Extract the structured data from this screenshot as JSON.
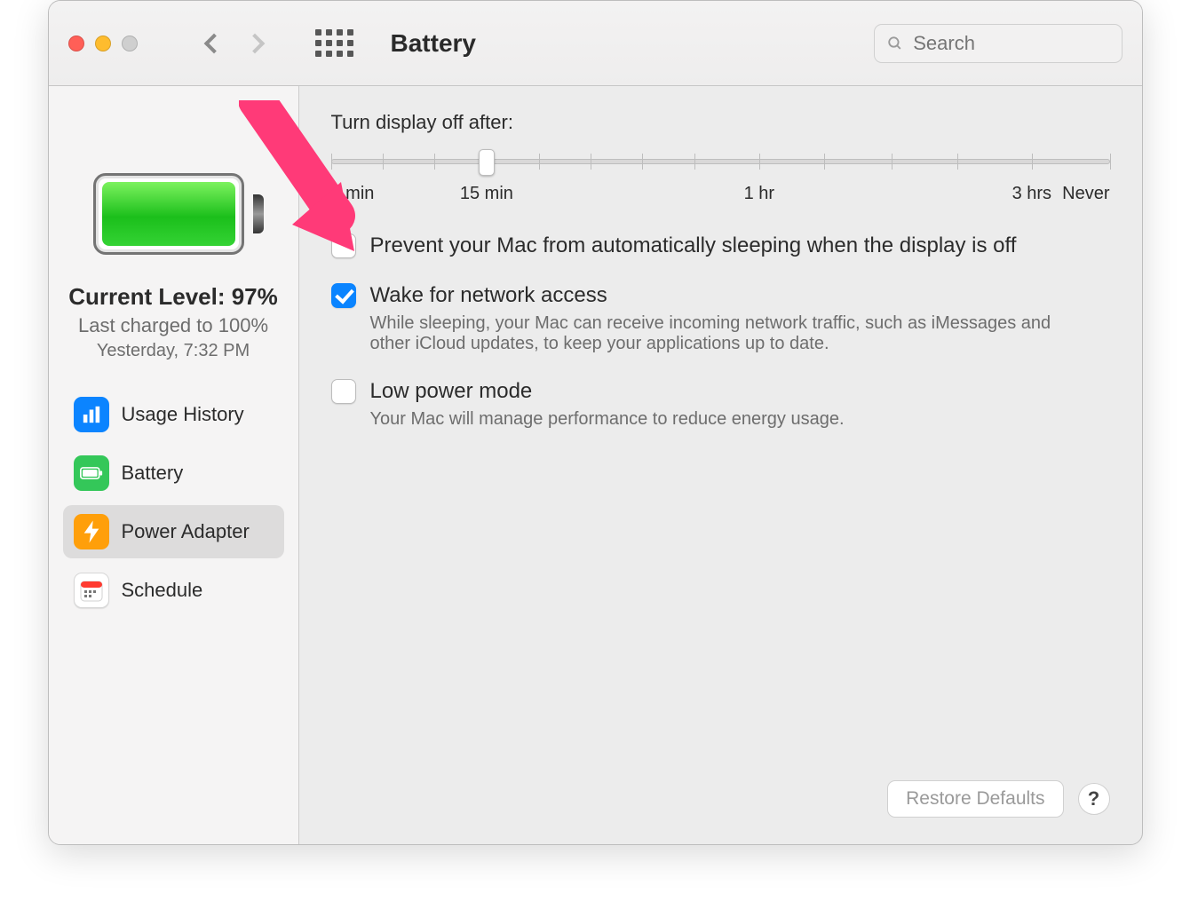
{
  "header": {
    "title": "Battery",
    "search_placeholder": "Search"
  },
  "sidebar": {
    "current_level_label": "Current Level: 97%",
    "last_charged_label": "Last charged to 100%",
    "last_charged_time": "Yesterday, 7:32 PM",
    "items": [
      {
        "label": "Usage History",
        "icon": "bar-chart-icon",
        "color": "#0b84ff"
      },
      {
        "label": "Battery",
        "icon": "battery-icon",
        "color": "#34c759"
      },
      {
        "label": "Power Adapter",
        "icon": "bolt-icon",
        "color": "#ff9f0a",
        "selected": true
      },
      {
        "label": "Schedule",
        "icon": "calendar-icon",
        "color": "#ffffff"
      }
    ]
  },
  "slider": {
    "title": "Turn display off after:",
    "labels": [
      "1 min",
      "15 min",
      "1 hr",
      "3 hrs",
      "Never"
    ],
    "label_positions_pct": [
      0,
      20,
      55,
      90,
      100
    ],
    "tick_positions_pct": [
      0,
      6.7,
      13.3,
      20,
      26.7,
      33.3,
      40,
      46.7,
      55,
      63.3,
      72,
      80.5,
      90,
      100
    ],
    "value_pct": 20
  },
  "options": [
    {
      "title": "Prevent your Mac from automatically sleeping when the display is off",
      "checked": false,
      "desc": ""
    },
    {
      "title": "Wake for network access",
      "checked": true,
      "desc": "While sleeping, your Mac can receive incoming network traffic, such as iMessages and other iCloud updates, to keep your applications up to date."
    },
    {
      "title": "Low power mode",
      "checked": false,
      "desc": "Your Mac will manage performance to reduce energy usage."
    }
  ],
  "footer": {
    "restore_label": "Restore Defaults",
    "help_label": "?"
  },
  "annotation": {
    "type": "arrow",
    "color": "#ff3a78",
    "target": "prevent-sleep-checkbox"
  }
}
